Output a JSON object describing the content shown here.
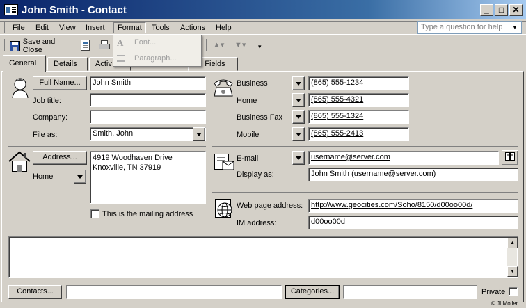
{
  "window": {
    "title": "John Smith - Contact"
  },
  "menu": {
    "items": [
      "File",
      "Edit",
      "View",
      "Insert",
      "Format",
      "Tools",
      "Actions",
      "Help"
    ],
    "ask_placeholder": "Type a question for help"
  },
  "toolbar": {
    "save_close": "Save and Close"
  },
  "format_menu": {
    "items": [
      "Font...",
      "Paragraph..."
    ]
  },
  "tabs": [
    "General",
    "Details",
    "Activ",
    "All Fields"
  ],
  "general": {
    "full_name_button": "Full Name...",
    "full_name": "John Smith",
    "job_title_label": "Job title:",
    "job_title": "",
    "company_label": "Company:",
    "company": "",
    "file_as_label": "File as:",
    "file_as": "Smith, John",
    "address_button": "Address...",
    "address_type": "Home",
    "address_line1": "4919 Woodhaven Drive",
    "address_line2": "Knoxville, TN  37919",
    "mailing_label": "This is the mailing address"
  },
  "phones": [
    {
      "label": "Business",
      "value": "(865) 555-1234"
    },
    {
      "label": "Home",
      "value": "(865) 555-4321"
    },
    {
      "label": "Business Fax",
      "value": "(865) 555-1324"
    },
    {
      "label": "Mobile",
      "value": "(865) 555-2413"
    }
  ],
  "email": {
    "label": "E-mail",
    "value": "username@server.com",
    "display_label": "Display as:",
    "display": "John Smith (username@server.com)"
  },
  "web": {
    "label": "Web page address:",
    "value": "http://www.geocities.com/Soho/8150/d00oo00d/",
    "im_label": "IM address:",
    "im": "d00oo00d"
  },
  "bottom": {
    "contacts_button": "Contacts...",
    "contacts_value": "",
    "categories_button": "Categories...",
    "categories_value": "",
    "private_label": "Private",
    "credit": "© JLMoller"
  }
}
